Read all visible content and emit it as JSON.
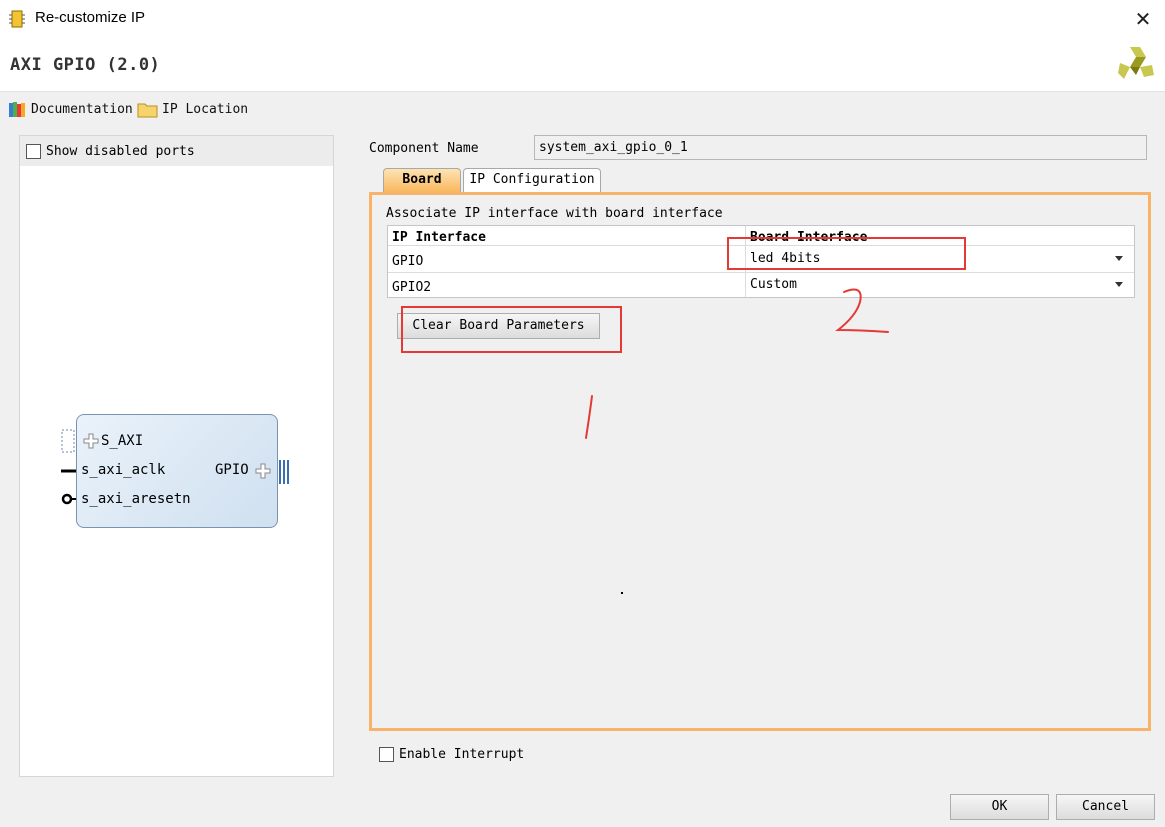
{
  "window": {
    "title": "Re-customize IP"
  },
  "header": {
    "ip_title": "AXI GPIO (2.0)"
  },
  "toolbar": {
    "documentation": "Documentation",
    "ip_location": "IP Location"
  },
  "left_panel": {
    "show_disabled_ports": "Show disabled ports",
    "show_disabled_ports_checked": false,
    "block": {
      "ports_left": [
        "S_AXI",
        "s_axi_aclk",
        "s_axi_aresetn"
      ],
      "port_right": "GPIO"
    }
  },
  "component": {
    "label": "Component Name",
    "value": "system_axi_gpio_0_1"
  },
  "tabs": [
    {
      "label": "Board",
      "active": true
    },
    {
      "label": "IP Configuration",
      "active": false
    }
  ],
  "board_tab": {
    "section_label": "Associate IP interface with board interface",
    "columns": [
      "IP Interface",
      "Board Interface"
    ],
    "rows": [
      {
        "ip_interface": "GPIO",
        "board_interface": "led 4bits"
      },
      {
        "ip_interface": "GPIO2",
        "board_interface": "Custom"
      }
    ],
    "clear_button": "Clear Board Parameters"
  },
  "enable_interrupt": {
    "label": "Enable Interrupt",
    "checked": false
  },
  "footer": {
    "ok": "OK",
    "cancel": "Cancel"
  },
  "annotations": {
    "mark_1": "1",
    "mark_2": "2",
    "highlight_color": "#e53935"
  }
}
